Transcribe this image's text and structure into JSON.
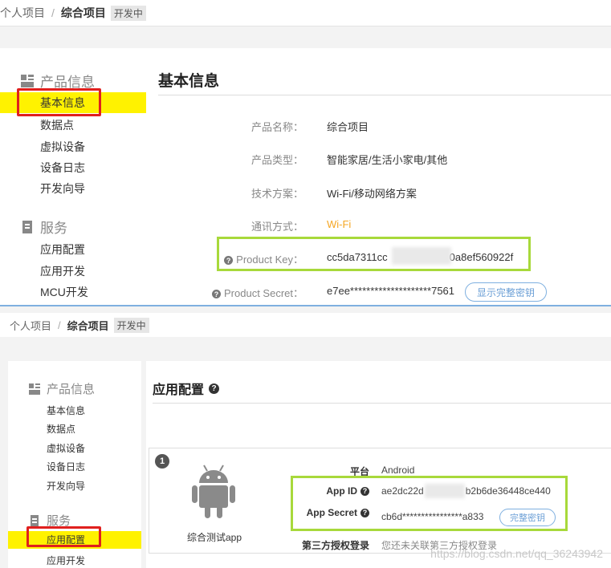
{
  "top": {
    "breadcrumb": {
      "personal": "个人项目",
      "sep": "/",
      "project": "综合项目",
      "status": "开发中"
    },
    "sidebar": {
      "section1": "产品信息",
      "items1": [
        "基本信息",
        "数据点",
        "虚拟设备",
        "设备日志",
        "开发向导"
      ],
      "section2": "服务",
      "items2": [
        "应用配置",
        "应用开发",
        "MCU开发"
      ]
    },
    "content": {
      "title": "基本信息",
      "rows": [
        {
          "label": "产品名称：",
          "value": "综合项目"
        },
        {
          "label": "产品类型：",
          "value": "智能家居/生活小家电/其他"
        },
        {
          "label": "技术方案：",
          "value": "Wi-Fi/移动网络方案"
        },
        {
          "label": "通讯方式：",
          "value": "Wi-Fi"
        }
      ],
      "product_key": {
        "label": "Product Key：",
        "value_start": "cc5da7311cc",
        "value_end": "0a8ef560922f"
      },
      "product_secret": {
        "label": "Product Secret：",
        "value": "e7ee********************7561",
        "button": "显示完整密钥"
      }
    }
  },
  "bottom": {
    "breadcrumb": {
      "personal": "个人项目",
      "sep": "/",
      "project": "综合项目",
      "status": "开发中"
    },
    "sidebar": {
      "section1": "产品信息",
      "items1": [
        "基本信息",
        "数据点",
        "虚拟设备",
        "设备日志",
        "开发向导"
      ],
      "section2": "服务",
      "items2": [
        "应用配置",
        "应用开发"
      ]
    },
    "content": {
      "title": "应用配置",
      "card": {
        "index": "1",
        "app_name": "综合测试app",
        "platform_label": "平台",
        "platform_value": "Android",
        "app_id_label": "App ID",
        "app_id_start": "ae2dc22d",
        "app_id_end": "b2b6de36448ce440",
        "app_secret_label": "App Secret",
        "app_secret_value": "cb6d****************a833",
        "secret_button": "完整密钥",
        "third_party_label": "第三方授权登录",
        "third_party_value": "您还未关联第三方授权登录"
      }
    },
    "watermark": "https://blog.csdn.net/qq_36243942"
  },
  "colors": {
    "active_highlight": "#fff200",
    "annotation_red": "#e0201e",
    "annotation_green": "#a8d93b",
    "link_blue": "#6b9fd6",
    "orange": "#f5a623"
  }
}
